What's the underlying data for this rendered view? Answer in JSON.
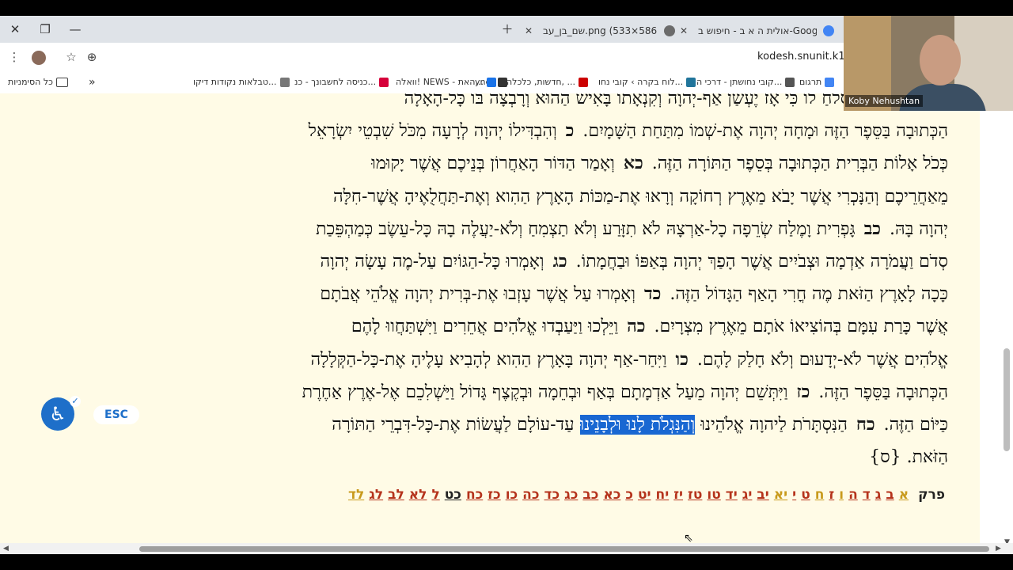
{
  "tabs": [
    {
      "title": "אולית ה א ב - חיפוש ב-Google",
      "favicon_color": "#4285f4",
      "active": false
    },
    {
      "title": "שם_בן_עב.png (533×586)",
      "favicon_color": "#6b6b6b",
      "active": false
    }
  ],
  "toolbar": {
    "url": "kodesh.snunit.k12.",
    "menu_icon": "⋮",
    "bookmark_icon": "☆",
    "zoom_icon": "⊕"
  },
  "bookmarks": [
    {
      "label": "תרגום",
      "color": "#4285f4"
    },
    {
      "label": "קובי נחושתן - דרכי ה...",
      "color": "#555555"
    },
    {
      "label": "לוח בקרה › קובי נחו...",
      "color": "#21759b"
    },
    {
      "label": "חדשות, כלכלה, ...",
      "color": "#cc0000"
    },
    {
      "label": "ynet",
      "color": "#333333"
    },
    {
      "label": "וואלה! NEWS - האת...",
      "color": "#1a73e8"
    },
    {
      "label": "כניסה לחשבונך - כנ...",
      "color": "#d6003a"
    },
    {
      "label": "טבלאות נקודות דיקו...",
      "color": "#777777"
    }
  ],
  "bookmarks_folder": "כל הסימניות",
  "passage": [
    [
      {
        "t": "לֹא-יֹאבֶה יְהוָה סְלֹחַ לוֹ כִּי אָז יֶעְשַׁן אַף-יְהוָה וְקִנְאָתוֹ בָּאִישׁ הַהוּא וְרָבְצָה בּוֹ כָּל-הָאָלָה"
      }
    ],
    [
      {
        "t": "הַכְּתוּבָה בַּסֵּפֶר הַזֶּה וּמָחָה יְהוָה אֶת-שְׁמוֹ מִתַּחַת הַשָּׁמָיִם. "
      },
      {
        "v": "כ"
      },
      {
        "t": " וְהִבְדִּילוֹ יְהוָה לְרָעָה מִכֹּל שִׁבְטֵי יִשְׂרָאֵל"
      }
    ],
    [
      {
        "t": "כְּכֹל אָלוֹת הַבְּרִית הַכְּתוּבָה בְּסֵפֶר הַתּוֹרָה הַזֶּה. "
      },
      {
        "v": "כא"
      },
      {
        "t": " וְאָמַר הַדּוֹר הָאַחֲרוֹן בְּנֵיכֶם אֲשֶׁר יָקוּמוּ"
      }
    ],
    [
      {
        "t": "מֵאַחֲרֵיכֶם וְהַנָּכְרִי אֲשֶׁר יָבֹא מֵאֶרֶץ רְחוֹקָה וְרָאוּ אֶת-מַכּוֹת הָאָרֶץ הַהִוא וְאֶת-תַּחֲלֻאֶיהָ אֲשֶׁר-חִלָּה"
      }
    ],
    [
      {
        "t": "יְהוָה בָּהּ. "
      },
      {
        "v": "כב"
      },
      {
        "t": " גָּפְרִית וָמֶלַח שְׂרֵפָה כָל-אַרְצָהּ לֹא תִזָּרַע וְלֹא תַצְמִחַ וְלֹא-יַעֲלֶה בָהּ כָּל-עֵשֶׂב  כְּמַהְפֵּכַת"
      }
    ],
    [
      {
        "t": "סְדֹם וַעֲמֹרָה אַדְמָה וּצְבֹיִים אֲשֶׁר הָפַךְ יְהוָה בְּאַפּוֹ וּבַחֲמָתוֹ. "
      },
      {
        "v": "כג"
      },
      {
        "t": " וְאָמְרוּ כָּל-הַגּוֹיִם עַל-מֶה עָשָׂה יְהוָה"
      }
    ],
    [
      {
        "t": "כָּכָה לָאָרֶץ הַזֹּאת מֶה חֳרִי הָאַף הַגָּדוֹל הַזֶּה. "
      },
      {
        "v": "כד"
      },
      {
        "t": " וְאָמְרוּ עַל אֲשֶׁר עָזְבוּ אֶת-בְּרִית יְהוָה אֱלֹהֵי אֲבֹתָם"
      }
    ],
    [
      {
        "t": "אֲשֶׁר כָּרַת עִמָּם בְּהוֹצִיאוֹ אֹתָם מֵאֶרֶץ מִצְרָיִם. "
      },
      {
        "v": "כה"
      },
      {
        "t": " וַיֵּלְכוּ וַיַּעַבְדוּ אֱלֹהִים אֲחֵרִים וַיִּשְׁתַּחֲווּ לָהֶם"
      }
    ],
    [
      {
        "t": "אֱלֹהִים אֲשֶׁר לֹא-יְדָעוּם וְלֹא חָלַק לָהֶם. "
      },
      {
        "v": "כו"
      },
      {
        "t": " וַיִּחַר-אַף יְהוָה בָּאָרֶץ הַהִוא לְהָבִיא עָלֶיהָ אֶת-כָּל-הַקְּלָלָה"
      }
    ],
    [
      {
        "t": "הַכְּתוּבָה בַּסֵּפֶר הַזֶּה. "
      },
      {
        "v": "כז"
      },
      {
        "t": " וַיִּתְּשֵׁם יְהוָה מֵעַל אַדְמָתָם בְּאַף וּבְחֵמָה וּבְקֶצֶף גָּדוֹל וַיַּשְׁלִכֵם אֶל-אֶרֶץ אַחֶרֶת"
      }
    ],
    [
      {
        "t": "כַּיּוֹם הַזֶּה. "
      },
      {
        "v": "כח"
      },
      {
        "t": " הַנִּסְתָּרֹת לַיהוָה אֱלֹהֵינוּ "
      },
      {
        "h": "וְהַנִּגְלֹת לָנוּ וּלְבָנֵינוּ"
      },
      {
        "t": " עַד-עוֹלָם לַעֲשׂוֹת אֶת-כָּל-דִּבְרֵי הַתּוֹרָה"
      }
    ],
    [
      {
        "t": "הַזֹּאת.  {ס}"
      }
    ]
  ],
  "chapters_label": "פרק",
  "chapters": [
    {
      "l": "א",
      "c": "#c89a1c"
    },
    {
      "l": "ב",
      "c": "#b5331c"
    },
    {
      "l": "ג",
      "c": "#b5331c"
    },
    {
      "l": "ד",
      "c": "#b5331c"
    },
    {
      "l": "ה",
      "c": "#b5331c"
    },
    {
      "l": "ו",
      "c": "#c89a1c"
    },
    {
      "l": "ז",
      "c": "#b5331c"
    },
    {
      "l": "ח",
      "c": "#c89a1c"
    },
    {
      "l": "ט",
      "c": "#b5331c"
    },
    {
      "l": "י",
      "c": "#b5331c"
    },
    {
      "l": "יא",
      "c": "#c89a1c"
    },
    {
      "l": "יב",
      "c": "#b5331c"
    },
    {
      "l": "יג",
      "c": "#b5331c"
    },
    {
      "l": "יד",
      "c": "#b5331c"
    },
    {
      "l": "טו",
      "c": "#b5331c"
    },
    {
      "l": "טז",
      "c": "#b5331c"
    },
    {
      "l": "יז",
      "c": "#b5331c"
    },
    {
      "l": "יח",
      "c": "#b5331c"
    },
    {
      "l": "יט",
      "c": "#b5331c"
    },
    {
      "l": "כ",
      "c": "#b5331c"
    },
    {
      "l": "כא",
      "c": "#b5331c"
    },
    {
      "l": "כב",
      "c": "#b5331c"
    },
    {
      "l": "כג",
      "c": "#b5331c"
    },
    {
      "l": "כד",
      "c": "#b5331c"
    },
    {
      "l": "כה",
      "c": "#b5331c"
    },
    {
      "l": "כו",
      "c": "#b5331c"
    },
    {
      "l": "כז",
      "c": "#b5331c"
    },
    {
      "l": "כח",
      "c": "#b5331c"
    },
    {
      "l": "כט",
      "c": "#222222"
    },
    {
      "l": "ל",
      "c": "#b5331c"
    },
    {
      "l": "לא",
      "c": "#b5331c"
    },
    {
      "l": "לב",
      "c": "#b5331c"
    },
    {
      "l": "לג",
      "c": "#b5331c"
    },
    {
      "l": "לד",
      "c": "#c89a1c"
    }
  ],
  "accessibility": {
    "esc_label": "ESC"
  },
  "webcam": {
    "name": "Koby Nehushtan"
  }
}
